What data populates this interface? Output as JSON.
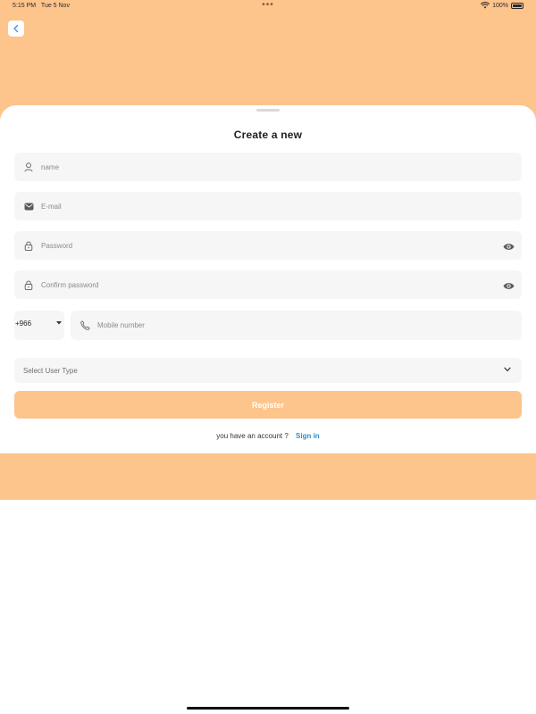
{
  "status_bar": {
    "time": "5:15 PM",
    "date": "Tue 5 Nov",
    "dots": "•••",
    "battery_text": "100%"
  },
  "form": {
    "title": "Create a new",
    "name_placeholder": "name",
    "email_placeholder": "E-mail",
    "password_placeholder": "Password",
    "confirm_password_placeholder": "Confirm password",
    "country_code": "+966",
    "mobile_placeholder": "Mobile number",
    "user_type_placeholder": "Select User Type",
    "register_label": "Register",
    "have_account_text": "you have an account ?",
    "signin_label": "Sign in"
  },
  "colors": {
    "accent": "#fdc48b",
    "link": "#2b8fd1",
    "field_bg": "#f6f6f6"
  }
}
